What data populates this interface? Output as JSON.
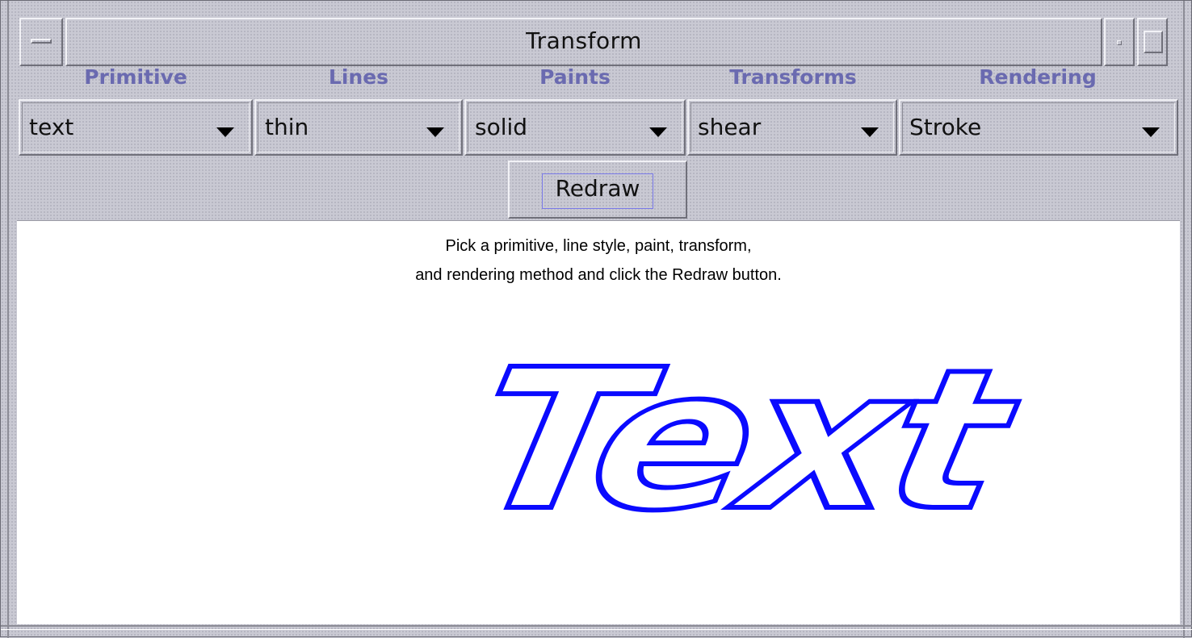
{
  "window": {
    "title": "Transform"
  },
  "labels": [
    "Primitive",
    "Lines",
    "Paints",
    "Transforms",
    "Rendering"
  ],
  "combos": [
    {
      "name": "primitive",
      "value": "text"
    },
    {
      "name": "lines",
      "value": "thin"
    },
    {
      "name": "paints",
      "value": "solid"
    },
    {
      "name": "transforms",
      "value": "shear"
    },
    {
      "name": "rendering",
      "value": "Stroke"
    }
  ],
  "redraw_label": "Redraw",
  "canvas": {
    "instruction_line1": "Pick a primitive, line style, paint, transform,",
    "instruction_line2": "and rendering method and click the Redraw button.",
    "sample_text": "Text",
    "stroke_color": "#0a0aff"
  },
  "colors": {
    "label": "#6a6ab0",
    "background": "#c9c9d3"
  }
}
